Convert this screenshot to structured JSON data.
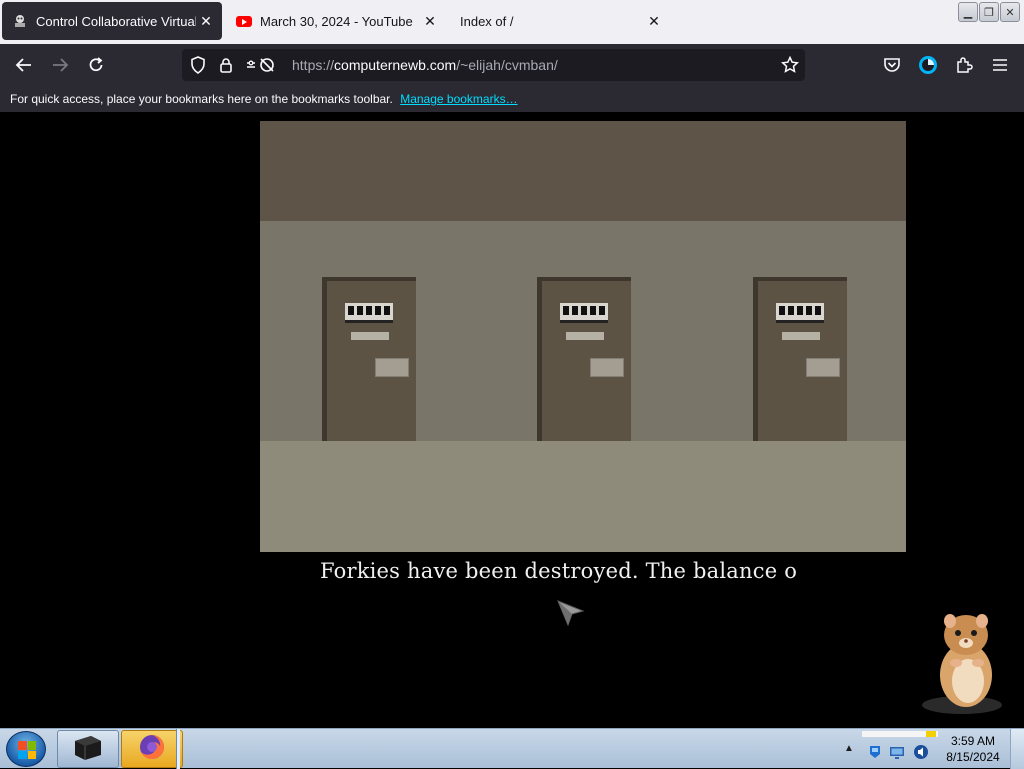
{
  "browser": {
    "tabs": [
      {
        "title": "Control Collaborative Virtual M",
        "active": true,
        "icon": "cvm-icon"
      },
      {
        "title": "March 30, 2024 - YouTube",
        "active": false,
        "icon": "youtube-icon"
      },
      {
        "title": "Index of /",
        "active": false,
        "icon": ""
      }
    ],
    "url": {
      "scheme": "https://",
      "host": "computernewb.com",
      "path": "/~elijah/cvmban/"
    },
    "bookmarks_bar": {
      "message": "For quick access, place your bookmarks here on the bookmarks toolbar.",
      "manage_link": "Manage bookmarks…"
    },
    "accent_color": "#00ddff"
  },
  "game": {
    "scene": "prison corridor with three cell doors",
    "subtitle": "Forkies have been destroyed. The balance o"
  },
  "taskbar": {
    "apps": [
      "media-player-icon",
      "firefox-icon"
    ],
    "clock": {
      "time": "3:59 AM",
      "date": "8/15/2024"
    }
  }
}
